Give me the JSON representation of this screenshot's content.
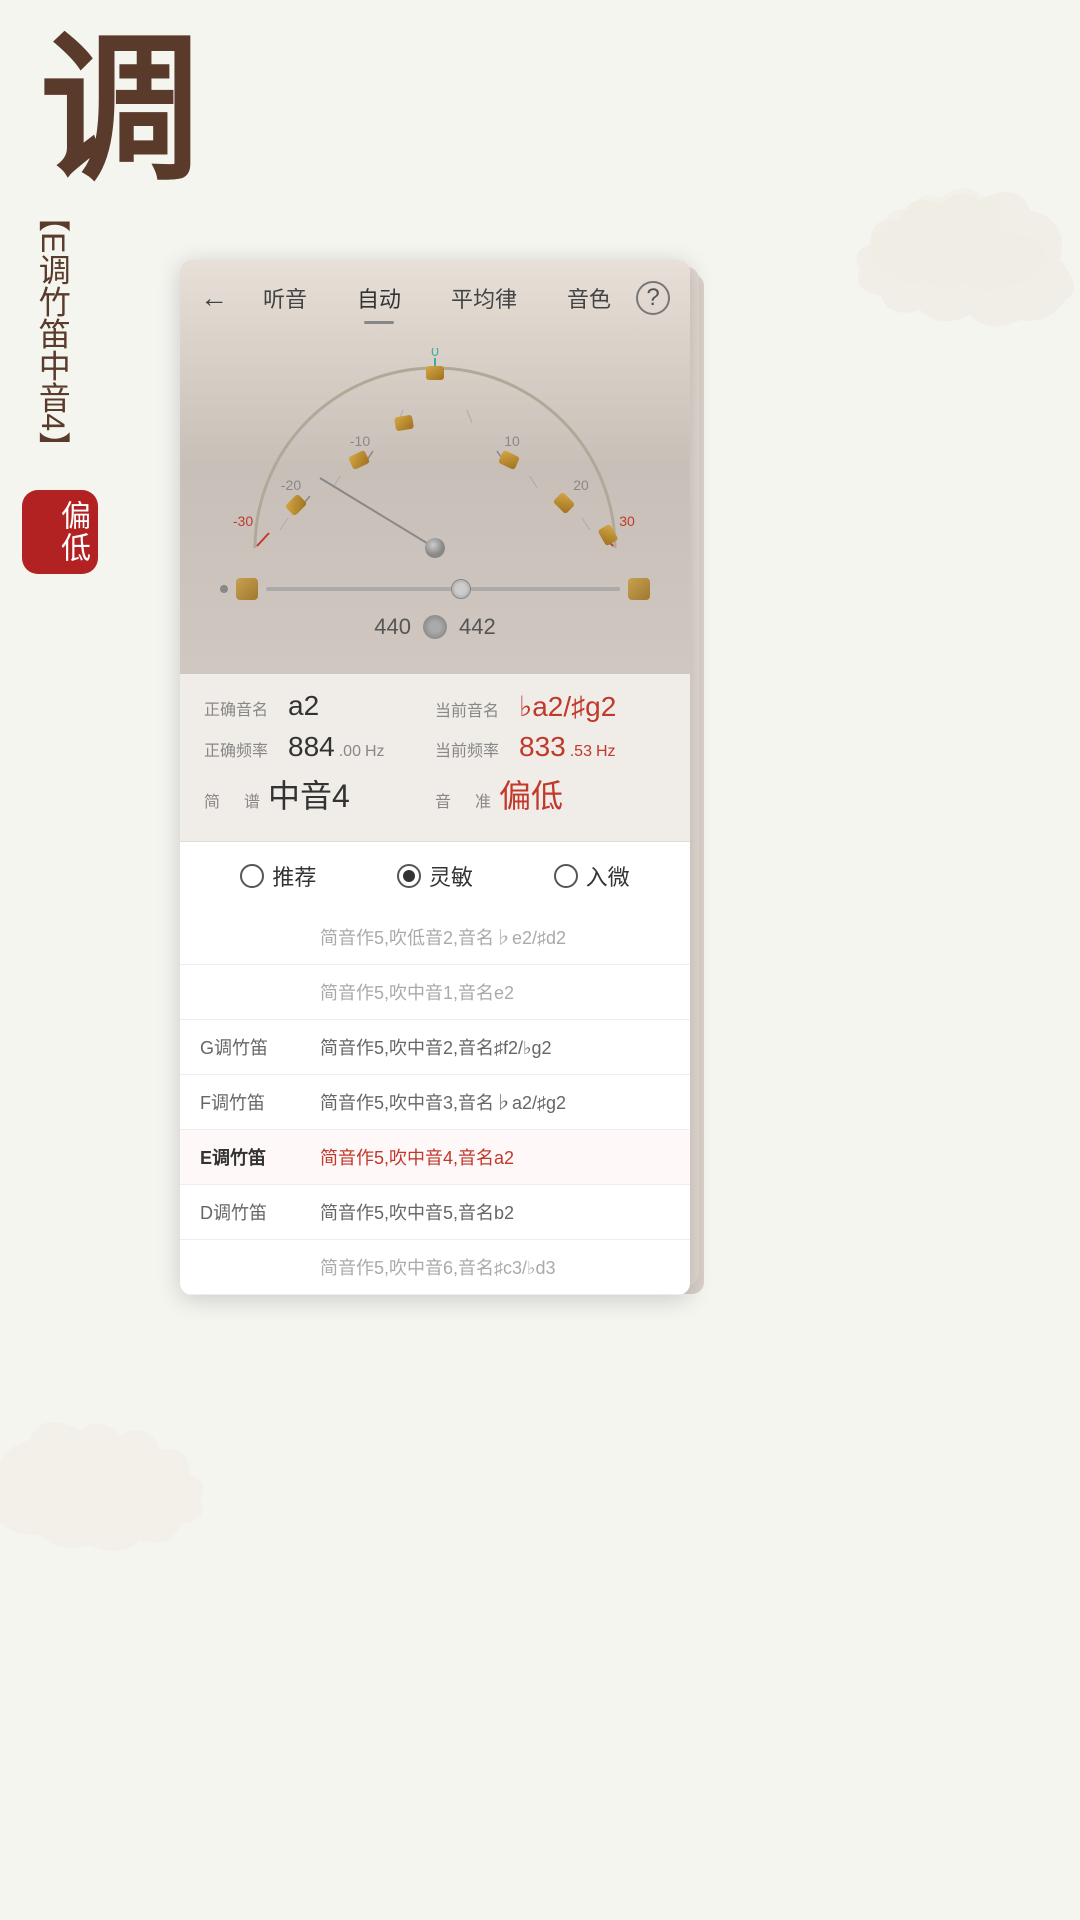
{
  "app": {
    "big_char": "调",
    "vertical_label": "E调竹笛中音4",
    "badge": "偏低"
  },
  "nav": {
    "back_icon": "←",
    "tabs": [
      {
        "label": "听音",
        "active": false
      },
      {
        "label": "自动",
        "active": true
      },
      {
        "label": "平均律",
        "active": false
      },
      {
        "label": "音色",
        "active": false
      }
    ],
    "help_label": "?"
  },
  "tuner": {
    "freq_left": "440",
    "freq_right": "442",
    "correct_note_label": "正确音名",
    "correct_note_value": "a2",
    "current_note_label": "当前音名",
    "current_note_value": "♭a2/♯g2",
    "correct_freq_label": "正确频率",
    "correct_freq_main": "884",
    "correct_freq_decimal": ".00",
    "correct_freq_unit": "Hz",
    "current_freq_label": "当前频率",
    "current_freq_main": "833",
    "current_freq_decimal": ".53",
    "current_freq_unit": "Hz",
    "jianpu_label": "简　谱",
    "jianpu_value": "中音4",
    "yinzhun_label": "音　准",
    "yinzhun_value": "偏低",
    "meter_ticks": [
      "-30",
      "-20",
      "-10",
      "0",
      "10",
      "20",
      "30"
    ]
  },
  "radio": {
    "options": [
      {
        "label": "推荐",
        "checked": false
      },
      {
        "label": "灵敏",
        "checked": true
      },
      {
        "label": "入微",
        "checked": false
      }
    ]
  },
  "list": {
    "items": [
      {
        "key": "",
        "value": "简音作5,吹低音2,音名♭e2/♯d2",
        "active": false,
        "gray": true
      },
      {
        "key": "",
        "value": "简音作5,吹中音1,音名e2",
        "active": false,
        "gray": true
      },
      {
        "key": "G调竹笛",
        "value": "简音作5,吹中音2,音名♯f2/♭g2",
        "active": false,
        "gray": false
      },
      {
        "key": "F调竹笛",
        "value": "简音作5,吹中音3,音名♭a2/♯g2",
        "active": false,
        "gray": false
      },
      {
        "key": "E调竹笛",
        "value": "简音作5,吹中音4,音名a2",
        "active": true,
        "gray": false
      },
      {
        "key": "D调竹笛",
        "value": "简音作5,吹中音5,音名b2",
        "active": false,
        "gray": false
      },
      {
        "key": "",
        "value": "简音作5,吹中音6,音名♯c3/♭d3",
        "active": false,
        "gray": true
      }
    ]
  }
}
